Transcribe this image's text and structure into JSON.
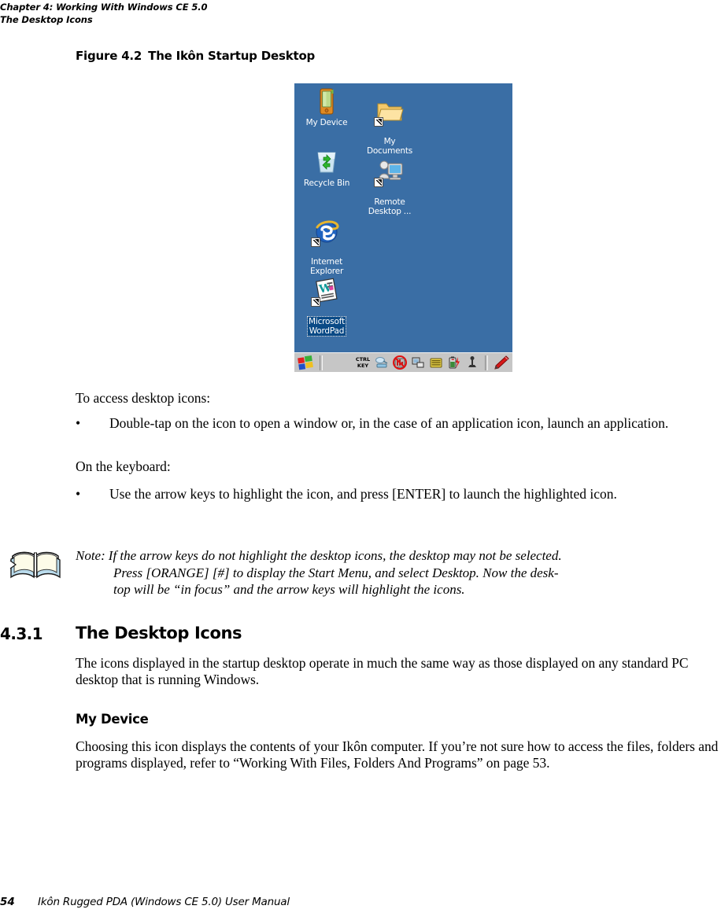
{
  "header": {
    "chapter_line": "Chapter 4:  Working With Windows CE 5.0",
    "section_line": "The Desktop Icons"
  },
  "figure": {
    "number": "Figure 4.2",
    "title": "The Ikôn Startup Desktop"
  },
  "device_screenshot": {
    "background_color": "#3a6ea5",
    "taskbar_color": "#c6c6c6",
    "selection_color": "#0a4a86",
    "desktop_icons": [
      {
        "name": "my-device",
        "label": "My Device",
        "icon": "pda-device-icon",
        "shortcut": false,
        "selected": false
      },
      {
        "name": "my-documents",
        "label": "My\nDocuments",
        "icon": "folder-icon",
        "shortcut": true,
        "selected": false
      },
      {
        "name": "recycle-bin",
        "label": "Recycle Bin",
        "icon": "recycle-bin-icon",
        "shortcut": false,
        "selected": false
      },
      {
        "name": "remote-desktop",
        "label": "Remote\nDesktop ...",
        "icon": "remote-desktop-icon",
        "shortcut": true,
        "selected": false
      },
      {
        "name": "internet-explorer",
        "label": "Internet\nExplorer",
        "icon": "internet-explorer-icon",
        "shortcut": true,
        "selected": false
      },
      {
        "name": "microsoft-wordpad",
        "label": "Microsoft\nWordPad",
        "icon": "wordpad-icon",
        "shortcut": true,
        "selected": true
      }
    ],
    "taskbar": {
      "start_button": "windows-flag-icon",
      "tray_items": [
        {
          "name": "ctrl-key-indicator",
          "icon": "ctrl-key-icon",
          "line1": "CTRL",
          "line2": "KEY"
        },
        {
          "name": "network-connection",
          "icon": "network-icon"
        },
        {
          "name": "radio-disabled",
          "icon": "radio-off-icon"
        },
        {
          "name": "desktop-display",
          "icon": "display-icon"
        },
        {
          "name": "keyboard-indicator",
          "icon": "keyboard-icon"
        },
        {
          "name": "battery-charging",
          "icon": "battery-charging-icon"
        },
        {
          "name": "signal-strength",
          "icon": "antenna-icon"
        },
        {
          "name": "stylus-pen",
          "icon": "pen-icon"
        }
      ]
    }
  },
  "body": {
    "intro_1": "To access desktop icons:",
    "bullet_1": "Double-tap on the icon to open a window or, in the case of an application icon, launch an application.",
    "intro_2": "On the keyboard:",
    "bullet_2": "Use the arrow keys to highlight the icon, and press [ENTER] to launch the highlighted icon.",
    "bullet_char": "•"
  },
  "note": {
    "label": "Note:",
    "line_1": "If the arrow keys do not highlight the desktop icons, the desktop may not be selected.",
    "line_2": "Press [ORANGE] [#] to display the Start Menu, and select Desktop. Now the desk-",
    "line_3": "top will be “in focus” and the arrow keys will highlight the icons.",
    "icon": "open-book-icon"
  },
  "section": {
    "number": "4.3.1",
    "title": "The Desktop Icons",
    "paragraph": "The icons displayed in the startup desktop operate in much the same way as those displayed on any standard PC desktop that is running Windows.",
    "subheading": "My Device",
    "sub_paragraph": "Choosing this icon displays the contents of your Ikôn computer. If you’re not sure how to access the files, folders and programs displayed, refer to “Working With Files, Folders And Programs” on page 53."
  },
  "footer": {
    "page_number": "54",
    "manual_title": "Ikôn Rugged PDA (Windows CE 5.0) User Manual"
  }
}
